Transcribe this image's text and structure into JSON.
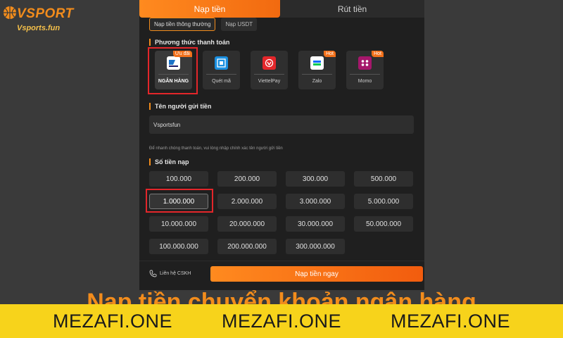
{
  "brand": {
    "title": "VSPORT",
    "subtitle": "Vsports.fun"
  },
  "tabs": {
    "deposit": "Nạp tiền",
    "withdraw": "Rút tiền"
  },
  "subtabs": {
    "normal": "Nạp tiền thông thường",
    "usdt": "Nạp USDT"
  },
  "payment": {
    "title": "Phương thức thanh toán",
    "methods": [
      {
        "label": "NGÂN HÀNG",
        "tag": "Ưu đãi",
        "icon": "bank-card-icon"
      },
      {
        "label": "Quét mã",
        "tag": "",
        "icon": "qr-scan-icon"
      },
      {
        "label": "ViettelPay",
        "tag": "",
        "icon": "viettelpay-icon"
      },
      {
        "label": "Zalo",
        "tag": "Hot",
        "icon": "zalopay-icon"
      },
      {
        "label": "Momo",
        "tag": "Hot",
        "icon": "momo-icon"
      }
    ]
  },
  "sender": {
    "title": "Tên người gửi tiền",
    "value": "Vsportsfun",
    "hint": "Để nhanh chóng thanh toán, vui lòng nhập chính xác tên người gửi tiền"
  },
  "amount": {
    "title": "Số tiền nạp",
    "options": [
      "100.000",
      "200.000",
      "300.000",
      "500.000",
      "1.000.000",
      "2.000.000",
      "3.000.000",
      "5.000.000",
      "10.000.000",
      "20.000.000",
      "30.000.000",
      "50.000.000",
      "100.000.000",
      "200.000.000",
      "300.000.000"
    ],
    "selected": "1.000.000"
  },
  "footer": {
    "support": "Liên hệ CSKH",
    "submit": "Nạp tiền ngay"
  },
  "headline": "Nạp tiền chuyển khoản ngân hàng",
  "banner": [
    "MEZAFI.ONE",
    "MEZAFI.ONE",
    "MEZAFI.ONE"
  ],
  "colors": {
    "accent": "#f28c1c",
    "highlight": "#e3262a",
    "banner": "#f7d31b"
  }
}
